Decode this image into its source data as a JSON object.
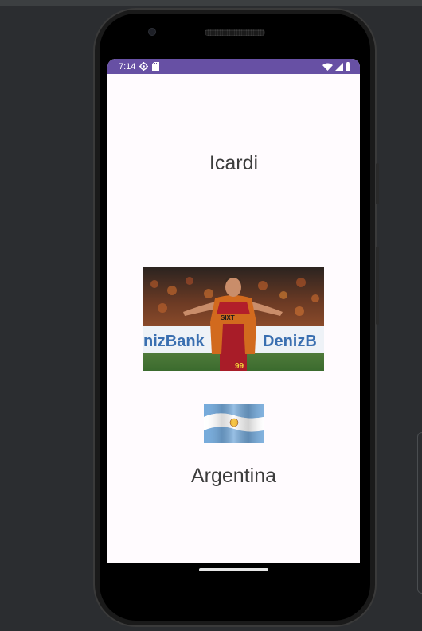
{
  "status_bar": {
    "time": "7:14",
    "left_icons": [
      "settings-icon",
      "sd-card-icon"
    ],
    "right_icons": [
      "wifi-icon",
      "signal-icon",
      "battery-icon"
    ],
    "color": "#6750a4"
  },
  "content": {
    "player_name": "Icardi",
    "player_image": "player-photo",
    "flag_image": "argentina-flag",
    "country": "Argentina",
    "photo_banner_text_left": "nizBank",
    "photo_banner_text_right": "DenizB",
    "jersey_number": "99",
    "jersey_sponsor": "SIXT"
  },
  "colors": {
    "screen_background": "#fffbfe",
    "text": "#3c3c3c",
    "flag_blue": "#75aadb"
  }
}
